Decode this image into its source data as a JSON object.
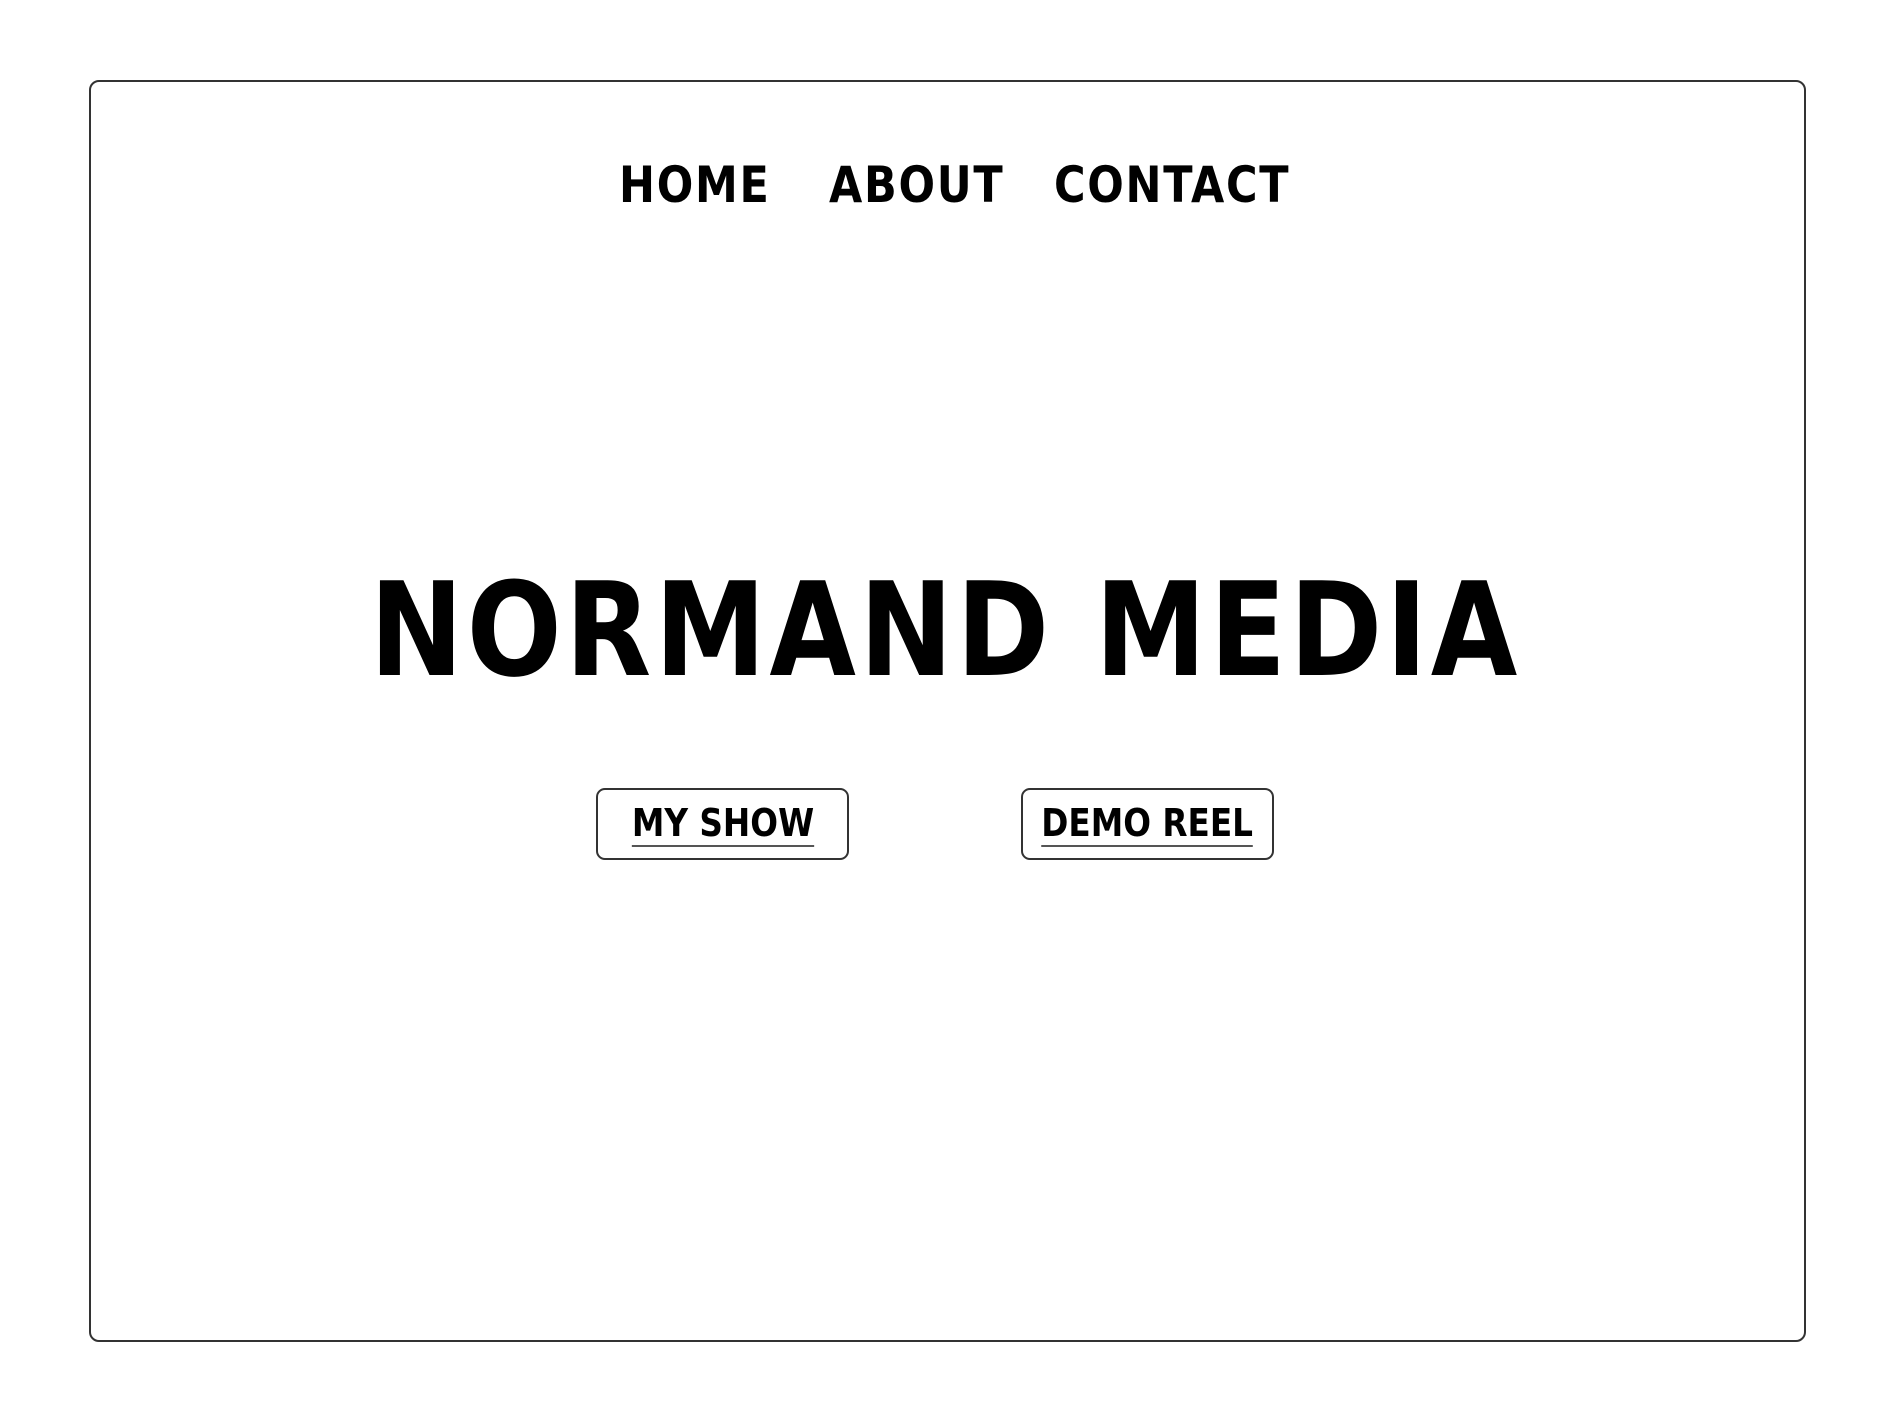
{
  "nav": {
    "items": [
      {
        "label": "HOME"
      },
      {
        "label": "ABOUT"
      },
      {
        "label": "CONTACT"
      }
    ]
  },
  "hero": {
    "title": "NORMAND MEDIA",
    "buttons": [
      {
        "label": "MY SHOW"
      },
      {
        "label": "DEMO REEL"
      }
    ]
  },
  "colors": {
    "text": "#000000",
    "border": "#333333",
    "background": "#ffffff"
  }
}
